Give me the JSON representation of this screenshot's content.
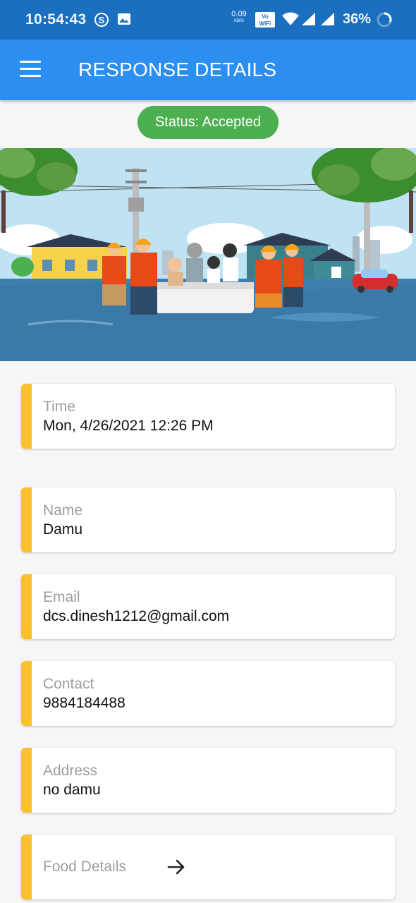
{
  "status_bar": {
    "time": "10:54:43",
    "net_speed": "0.09",
    "net_unit": "KB/S",
    "battery": "36%"
  },
  "app_bar": {
    "title": "RESPONSE DETAILS"
  },
  "status_badge": {
    "text": "Status: Accepted",
    "color": "#4caf50"
  },
  "details": {
    "time": {
      "label": "Time",
      "value": "Mon, 4/26/2021 12:26 PM"
    },
    "name": {
      "label": "Name",
      "value": "Damu"
    },
    "email": {
      "label": "Email",
      "value": "dcs.dinesh1212@gmail.com"
    },
    "contact": {
      "label": "Contact",
      "value": "9884184488"
    },
    "address": {
      "label": "Address",
      "value": "no damu"
    },
    "food": {
      "label": "Food Details"
    }
  },
  "colors": {
    "status_bar": "#1a6fc0",
    "app_bar": "#2b8ef0",
    "card_accent": "#fbc02d",
    "label": "#9e9e9e"
  },
  "icons": [
    "skype-icon",
    "image-icon",
    "volte-icon",
    "wifi-icon",
    "signal-icon",
    "battery-icon",
    "menu-icon",
    "arrow-right-icon"
  ]
}
